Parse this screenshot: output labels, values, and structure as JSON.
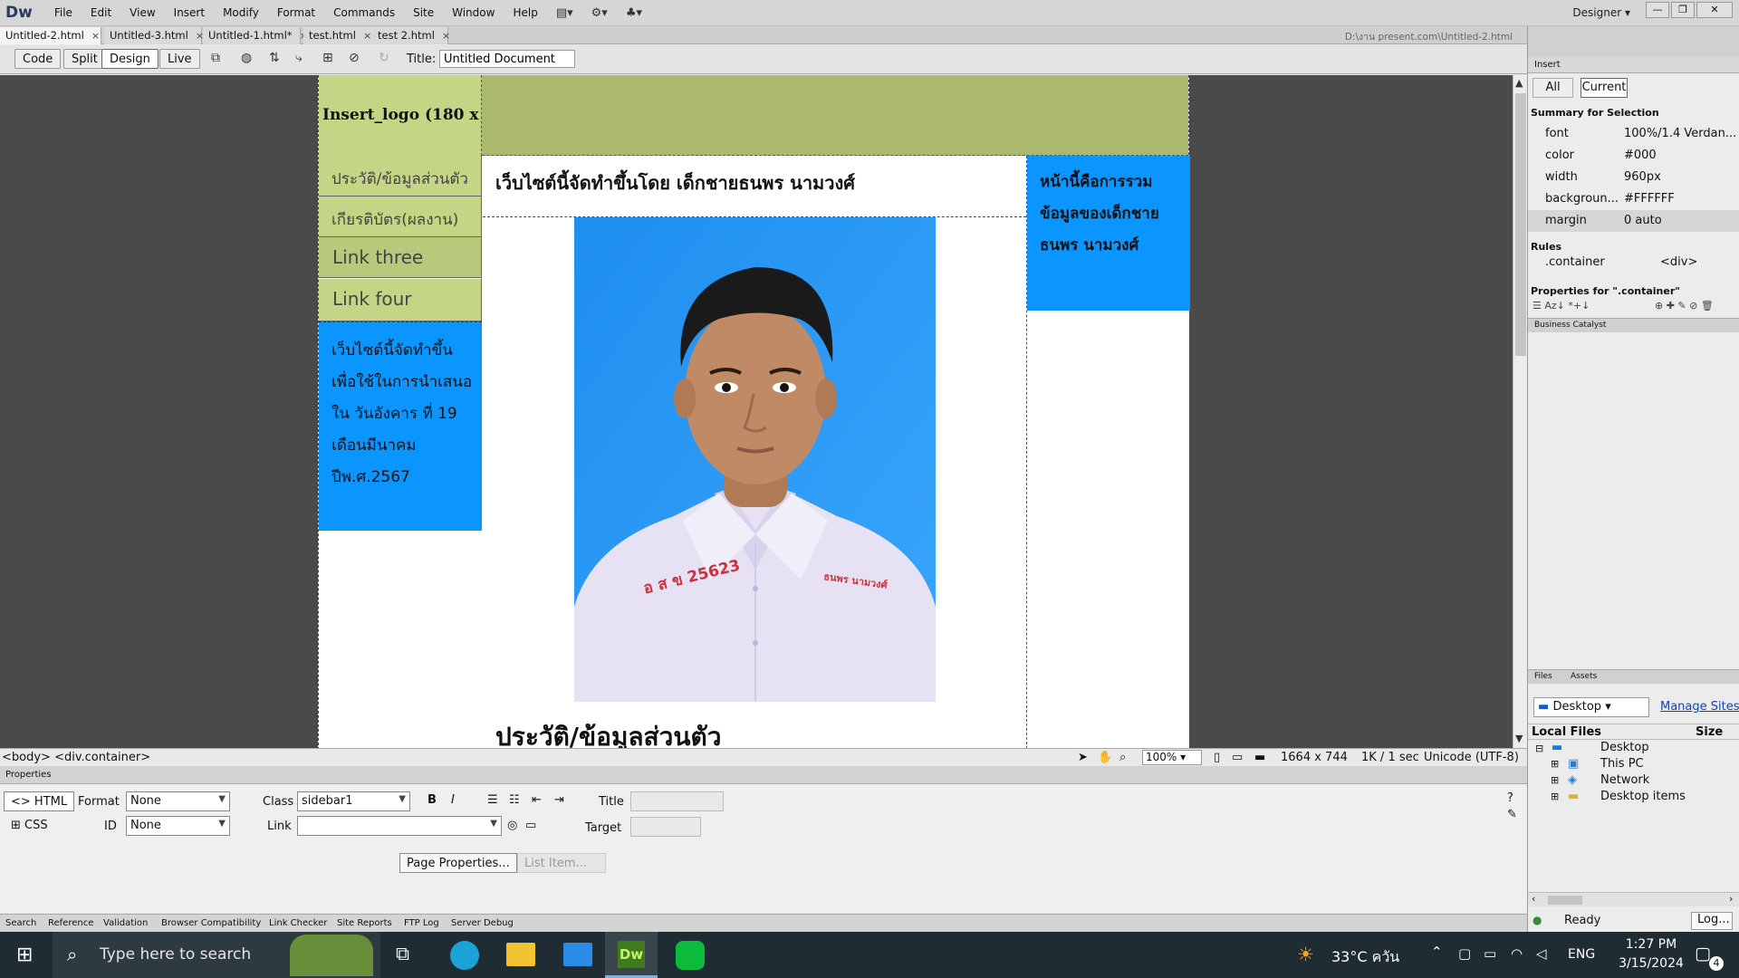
{
  "app": {
    "name": "Dw",
    "workspace": "Designer"
  },
  "menu": [
    "File",
    "Edit",
    "View",
    "Insert",
    "Modify",
    "Format",
    "Commands",
    "Site",
    "Window",
    "Help"
  ],
  "tabs": [
    {
      "label": "Untitled-2.html",
      "active": true
    },
    {
      "label": "Untitled-3.html"
    },
    {
      "label": "Untitled-1.html*"
    },
    {
      "label": "test.html"
    },
    {
      "label": "test 2.html"
    }
  ],
  "doc_path": "D:\\งาน present.com\\Untitled-2.html",
  "toolbar": {
    "code": "Code",
    "split": "Split",
    "design": "Design",
    "live": "Live",
    "title_label": "Title:",
    "title_value": "Untitled Document"
  },
  "page": {
    "logo": "Insert_logo (180 x ...",
    "nav": [
      "ประวัติ/ข้อมูลส่วนตัว",
      "เกียรติบัตร(ผลงาน)",
      "Link three",
      "Link four"
    ],
    "sidebar1_note": [
      "เว็บไซต์นี้จัดทำขึ้น",
      "เพื่อใช้ในการนำเสนอ",
      "ใน วันอังคาร ที่ 19",
      "เดือนมีนาคม",
      "ปีพ.ศ.2567"
    ],
    "content_heading": "เว็บไซต์นี้จัดทำขึ้นโดย เด็กชายธนพร นามวงศ์",
    "content_subheading": "ประวัติ/ข้อมูลส่วนตัว",
    "shirt_text": "อ ส ข 25623",
    "shirt_name": "ธนพร นามวงศ์",
    "sidebar2_note": [
      "หน้านี้คือการรวม",
      "ข้อมูลของเด็กชาย",
      "ธนพร นามวงศ์"
    ]
  },
  "status": {
    "tags": "<body> <div.container>",
    "zoom": "100%",
    "size": "1664 x 744",
    "download": "1K / 1 sec",
    "encoding": "Unicode (UTF-8)"
  },
  "properties": {
    "header": "Properties",
    "html": "HTML",
    "css": "CSS",
    "format_label": "Format",
    "format_value": "None",
    "id_label": "ID",
    "id_value": "None",
    "class_label": "Class",
    "class_value": "sidebar1",
    "link_label": "Link",
    "title_label": "Title",
    "target_label": "Target",
    "page_props": "Page Properties...",
    "list_item": "List Item..."
  },
  "bottom_tabs": [
    "Search",
    "Reference",
    "Validation",
    "Browser Compatibility",
    "Link Checker",
    "Site Reports",
    "FTP Log",
    "Server Debug"
  ],
  "right_panel": {
    "insert": "Insert",
    "all": "All",
    "current": "Current",
    "summary": "Summary for Selection",
    "props": [
      {
        "k": "font",
        "v": "100%/1.4 Verdan..."
      },
      {
        "k": "color",
        "v": "#000"
      },
      {
        "k": "width",
        "v": "960px"
      },
      {
        "k": "backgroun...",
        "v": "#FFFFFF"
      },
      {
        "k": "margin",
        "v": "0 auto"
      }
    ],
    "rules_label": "Rules",
    "rule_selector": ".container",
    "rule_tag": "<div>",
    "props_for": "Properties for \".container\"",
    "business": "Business Catalyst",
    "files_tab": "Files",
    "assets_tab": "Assets",
    "site_select": "Desktop",
    "manage": "Manage Sites",
    "local_files": "Local Files",
    "size": "Size",
    "tree": [
      "Desktop",
      "This PC",
      "Network",
      "Desktop items"
    ],
    "ready": "Ready",
    "log": "Log..."
  },
  "taskbar": {
    "search": "Type here to search",
    "weather": "33°C  ควัน",
    "lang": "ENG",
    "time": "1:27 PM",
    "date": "3/15/2024",
    "notif": "4"
  }
}
